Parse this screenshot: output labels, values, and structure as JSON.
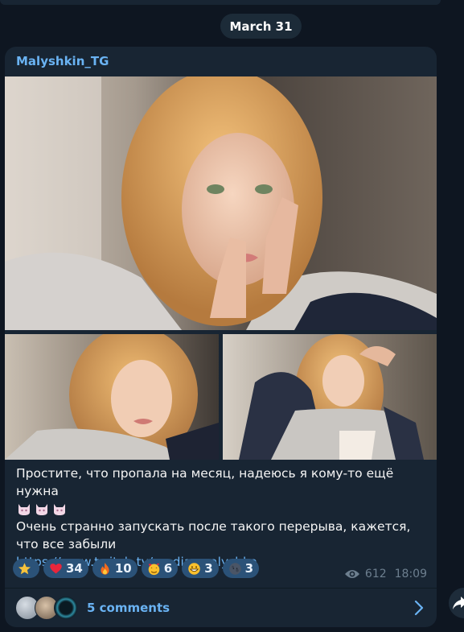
{
  "date_separator": "March 31",
  "post": {
    "author": "Malyshkin_TG",
    "text_line1": "Простите, что пропала на месяц, надеюсь я кому-то ещё нужна",
    "text_line2": "Очень странно запускать после такого перерыва, кажется, что все забыли",
    "link": "https://www.twitch.tv/media_malyshka",
    "reactions": [
      {
        "emoji": "star",
        "count": ""
      },
      {
        "emoji": "red-heart",
        "count": "34"
      },
      {
        "emoji": "fire",
        "count": "10"
      },
      {
        "emoji": "smiling-face-with-hearts",
        "count": "6"
      },
      {
        "emoji": "grinning-face",
        "count": "3"
      },
      {
        "emoji": "new-moon-face",
        "count": "3"
      }
    ],
    "views": "612",
    "time": "18:09",
    "comments_label": "5 comments"
  },
  "colors": {
    "background": "#0e1621",
    "bubble": "#182533",
    "accent": "#6ab3f3",
    "reaction_bg": "#2b5278",
    "meta": "#6d7f8f"
  },
  "icons": [
    "eye-icon",
    "chevron-right-icon",
    "share-icon"
  ]
}
